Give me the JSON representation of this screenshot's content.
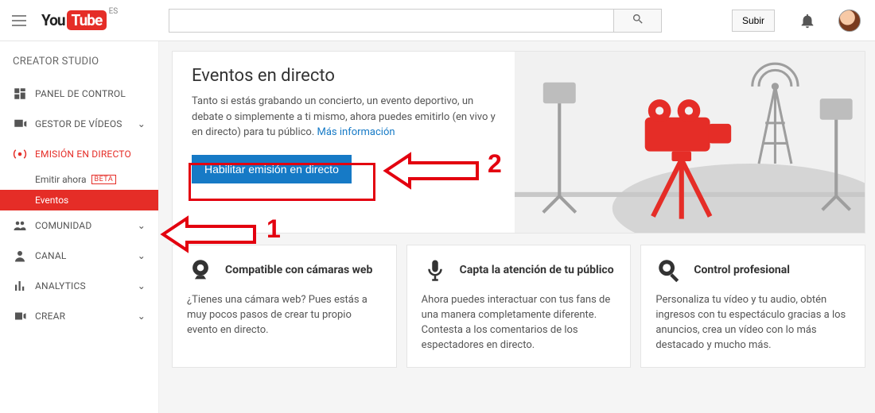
{
  "header": {
    "region": "ES",
    "search_placeholder": "",
    "search_value": "",
    "upload_label": "Subir"
  },
  "sidebar": {
    "studio_title": "CREATOR STUDIO",
    "items": [
      {
        "label": "PANEL DE CONTROL",
        "icon": "dashboard"
      },
      {
        "label": "GESTOR DE VÍDEOS",
        "icon": "video-manager",
        "expandable": true
      },
      {
        "label": "EMISIÓN EN DIRECTO",
        "icon": "live",
        "live": true
      },
      {
        "label": "COMUNIDAD",
        "icon": "community",
        "expandable": true
      },
      {
        "label": "CANAL",
        "icon": "channel",
        "expandable": true
      },
      {
        "label": "ANALYTICS",
        "icon": "analytics",
        "expandable": true
      },
      {
        "label": "CREAR",
        "icon": "create",
        "expandable": true
      }
    ],
    "live_sub": {
      "stream_now": "Emitir ahora",
      "stream_now_badge": "BETA",
      "events": "Eventos"
    }
  },
  "hero": {
    "title": "Eventos en directo",
    "body": "Tanto si estás grabando un concierto, un evento deportivo, un debate o simplemente a ti mismo, ahora puedes emitirlo (en vivo y en directo) para tu público.",
    "more_label": "Más información",
    "enable_label": "Habilitar emisión en directo"
  },
  "features": [
    {
      "title": "Compatible con cámaras web",
      "body": "¿Tienes una cámara web? Pues estás a muy pocos pasos de crear tu propio evento en directo."
    },
    {
      "title": "Capta la atención de tu público",
      "body": "Ahora puedes interactuar con tus fans de una manera completamente diferente. Contesta a los comentarios de los espectadores en directo."
    },
    {
      "title": "Control profesional",
      "body": "Personaliza tu vídeo y tu audio, obtén ingresos con tu espectáculo gracias a los anuncios, crea un vídeo con lo más destacado y mucho más."
    }
  ],
  "annotations": {
    "label1": "1",
    "label2": "2"
  }
}
